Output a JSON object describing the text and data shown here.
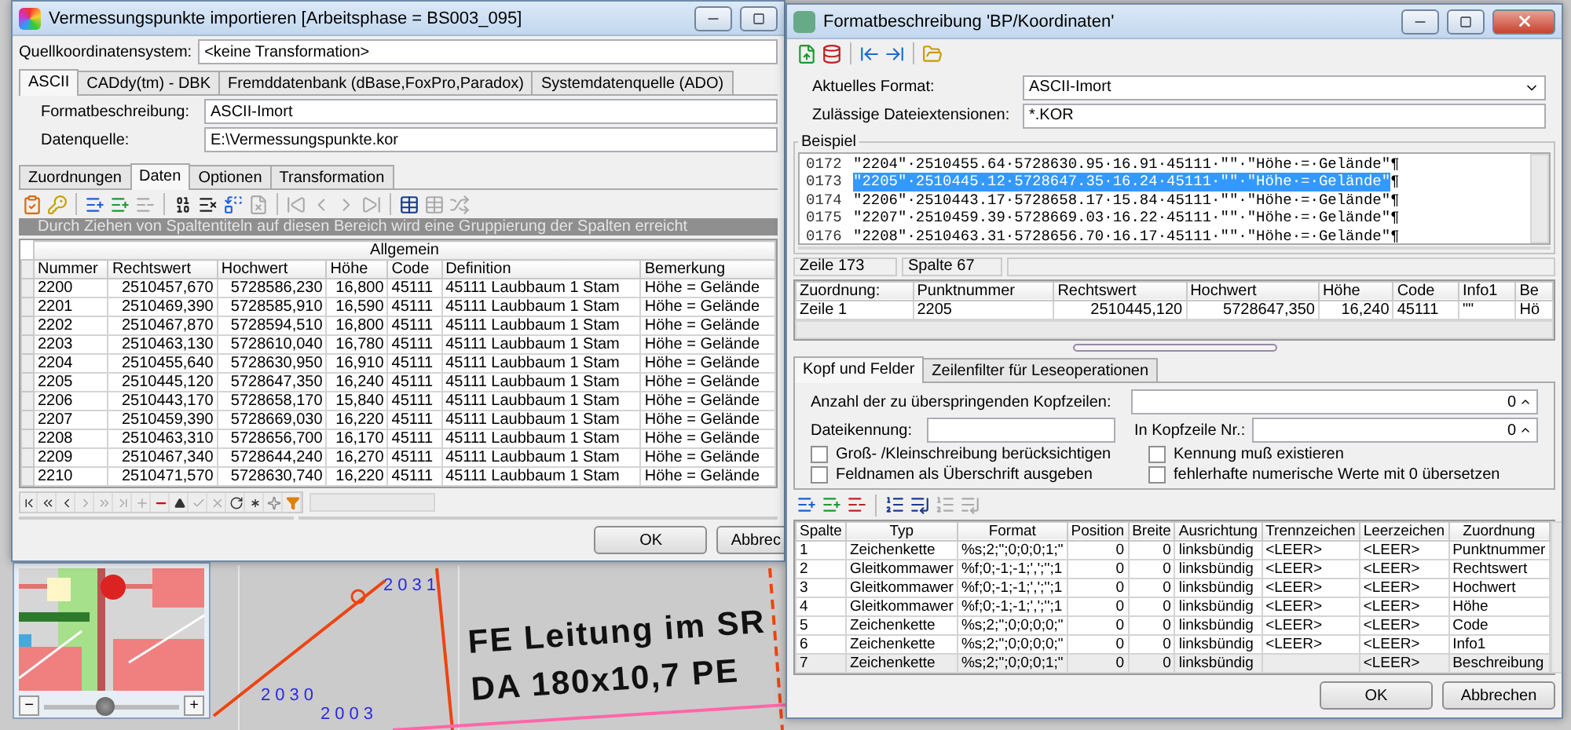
{
  "map": {
    "labels": [
      {
        "text": "2031",
        "kind": "point"
      },
      {
        "text": "2030",
        "kind": "point"
      },
      {
        "text": "2003",
        "kind": "point"
      },
      {
        "text": "FE Leitung im SR",
        "kind": "note"
      },
      {
        "text": "DA 180x10,7 PE",
        "kind": "note"
      }
    ],
    "zoom": {
      "minus": "−",
      "plus": "+",
      "level": 0.45
    }
  },
  "import_window": {
    "title": "Vermessungspunkte importieren [Arbeitsphase = BS003_095]",
    "source_label": "Quellkoordinatensystem:",
    "source_value": "<keine Transformation>",
    "source_tabs": [
      {
        "label": "ASCII",
        "selected": true
      },
      {
        "label": "CADdy(tm) - DBK",
        "selected": false
      },
      {
        "label": "Fremddatenbank (dBase,FoxPro,Paradox)",
        "selected": false
      },
      {
        "label": "Systemdatenquelle (ADO)",
        "selected": false
      }
    ],
    "format_label": "Formatbeschreibung:",
    "format_value": "ASCII-Imort",
    "datasource_label": "Datenquelle:",
    "datasource_value": "E:\\Vermessungspunkte.kor",
    "tabs": [
      {
        "label": "Zuordnungen",
        "selected": false
      },
      {
        "label": "Daten",
        "selected": true
      },
      {
        "label": "Optionen",
        "selected": false
      },
      {
        "label": "Transformation",
        "selected": false
      }
    ],
    "group_hint": "Durch Ziehen von Spaltentiteln auf diesen Bereich wird eine Gruppierung der Spalten erreicht",
    "table": {
      "band": "Allgemein",
      "columns": [
        "Nummer",
        "Rechtswert",
        "Hochwert",
        "Höhe",
        "Code",
        "Definition",
        "Bemerkung"
      ],
      "rows": [
        [
          "2200",
          "2510457,670",
          "5728586,230",
          "16,800",
          "45111",
          "45111 Laubbaum 1 Stam",
          "Höhe = Gelände"
        ],
        [
          "2201",
          "2510469,390",
          "5728585,910",
          "16,590",
          "45111",
          "45111 Laubbaum 1 Stam",
          "Höhe = Gelände"
        ],
        [
          "2202",
          "2510467,870",
          "5728594,510",
          "16,800",
          "45111",
          "45111 Laubbaum 1 Stam",
          "Höhe = Gelände"
        ],
        [
          "2203",
          "2510463,130",
          "5728610,040",
          "16,780",
          "45111",
          "45111 Laubbaum 1 Stam",
          "Höhe = Gelände"
        ],
        [
          "2204",
          "2510455,640",
          "5728630,950",
          "16,910",
          "45111",
          "45111 Laubbaum 1 Stam",
          "Höhe = Gelände"
        ],
        [
          "2205",
          "2510445,120",
          "5728647,350",
          "16,240",
          "45111",
          "45111 Laubbaum 1 Stam",
          "Höhe = Gelände"
        ],
        [
          "2206",
          "2510443,170",
          "5728658,170",
          "15,840",
          "45111",
          "45111 Laubbaum 1 Stam",
          "Höhe = Gelände"
        ],
        [
          "2207",
          "2510459,390",
          "5728669,030",
          "16,220",
          "45111",
          "45111 Laubbaum 1 Stam",
          "Höhe = Gelände"
        ],
        [
          "2208",
          "2510463,310",
          "5728656,700",
          "16,170",
          "45111",
          "45111 Laubbaum 1 Stam",
          "Höhe = Gelände"
        ],
        [
          "2209",
          "2510467,340",
          "5728644,240",
          "16,270",
          "45111",
          "45111 Laubbaum 1 Stam",
          "Höhe = Gelände"
        ],
        [
          "2210",
          "2510471,570",
          "5728630,740",
          "16,220",
          "45111",
          "45111 Laubbaum 1 Stam",
          "Höhe = Gelände"
        ]
      ]
    },
    "buttons": [
      "OK",
      "Abbrec"
    ]
  },
  "format_window": {
    "title": "Formatbeschreibung 'BP/Koordinaten'",
    "current_format_label": "Aktuelles Format:",
    "current_format_value": "ASCII-Imort",
    "extensions_label": "Zulässige Dateiextensionen:",
    "extensions_value": "*.KOR",
    "example": {
      "title": "Beispiel",
      "lines": [
        {
          "number": "0172",
          "text": "\"2204\"·2510455.64·5728630.95·16.91·45111·\"\"·\"Höhe·=·Gelände\"",
          "eol": "¶",
          "selected": false
        },
        {
          "number": "0173",
          "text": "\"2205\"·2510445.12·5728647.35·16.24·45111·\"\"·\"Höhe·=·Gelände\"",
          "eol": "¶",
          "selected": true
        },
        {
          "number": "0174",
          "text": "\"2206\"·2510443.17·5728658.17·15.84·45111·\"\"·\"Höhe·=·Gelände\"",
          "eol": "¶",
          "selected": false
        },
        {
          "number": "0175",
          "text": "\"2207\"·2510459.39·5728669.03·16.22·45111·\"\"·\"Höhe·=·Gelände\"",
          "eol": "¶",
          "selected": false
        },
        {
          "number": "0176",
          "text": "\"2208\"·2510463.31·5728656.70·16.17·45111·\"\"·\"Höhe·=·Gelände\"",
          "eol": "¶",
          "selected": false
        }
      ]
    },
    "status": [
      "Zeile 173",
      "Spalte 67"
    ],
    "mapping": {
      "columns": [
        "Zuordnung:",
        "Punktnummer",
        "Rechtswert",
        "Hochwert",
        "Höhe",
        "Code",
        "Info1",
        "Be"
      ],
      "rows": [
        [
          "Zeile 1",
          "2205",
          "2510445,120",
          "5728647,350",
          "16,240",
          "45111",
          "\"\"",
          "Hö"
        ]
      ]
    },
    "tabs": [
      {
        "label": "Kopf und Felder",
        "selected": true
      },
      {
        "label": "Zeilenfilter für Leseoperationen",
        "selected": false
      }
    ],
    "skip_label": "Anzahl der zu überspringenden Kopfzeilen:",
    "skip_value": "0",
    "file_id_label": "Dateikennung:",
    "header_line_label": "In Kopfzeile Nr.:",
    "header_line_value": "0",
    "options": [
      {
        "label": "Groß- /Kleinschreibung berücksichtigen",
        "checked": false
      },
      {
        "label": "Kennung muß existieren",
        "checked": false
      },
      {
        "label": "Feldnamen als Überschrift ausgeben",
        "checked": false
      },
      {
        "label": "fehlerhafte numerische Werte mit 0 übersetzen",
        "checked": false
      }
    ],
    "fields_table": {
      "columns": [
        "Spalte",
        "Typ",
        "Format",
        "Position",
        "Breite",
        "Ausrichtung",
        "Trennzeichen",
        "Leerzeichen",
        "Zuordnung"
      ],
      "rows": [
        {
          "cells": [
            "1",
            "Zeichenkette",
            "%s;2;\";0;0;0;1;\"",
            "0",
            "0",
            "linksbündig",
            "<LEER>",
            "<LEER>",
            "Punktnummer"
          ],
          "selected": false
        },
        {
          "cells": [
            "2",
            "Gleitkommawer",
            "%f;0;-1;-1;',';'';1",
            "0",
            "0",
            "linksbündig",
            "<LEER>",
            "<LEER>",
            "Rechtswert"
          ],
          "selected": false
        },
        {
          "cells": [
            "3",
            "Gleitkommawer",
            "%f;0;-1;-1;',';'';1",
            "0",
            "0",
            "linksbündig",
            "<LEER>",
            "<LEER>",
            "Hochwert"
          ],
          "selected": false
        },
        {
          "cells": [
            "4",
            "Gleitkommawer",
            "%f;0;-1;-1;',';'';1",
            "0",
            "0",
            "linksbündig",
            "<LEER>",
            "<LEER>",
            "Höhe"
          ],
          "selected": false
        },
        {
          "cells": [
            "5",
            "Zeichenkette",
            "%s;2;\";0;0;0;0;\"",
            "0",
            "0",
            "linksbündig",
            "<LEER>",
            "<LEER>",
            "Code"
          ],
          "selected": false
        },
        {
          "cells": [
            "6",
            "Zeichenkette",
            "%s;2;\";0;0;0;0;\"",
            "0",
            "0",
            "linksbündig",
            "<LEER>",
            "<LEER>",
            "Info1"
          ],
          "selected": false
        },
        {
          "cells": [
            "7",
            "Zeichenkette",
            "%s;2;\";0;0;0;1;\"",
            "0",
            "0",
            "linksbündig",
            "",
            "<LEER>",
            "Beschreibung"
          ],
          "selected": true
        }
      ]
    },
    "buttons": [
      "OK",
      "Abbrechen"
    ]
  }
}
